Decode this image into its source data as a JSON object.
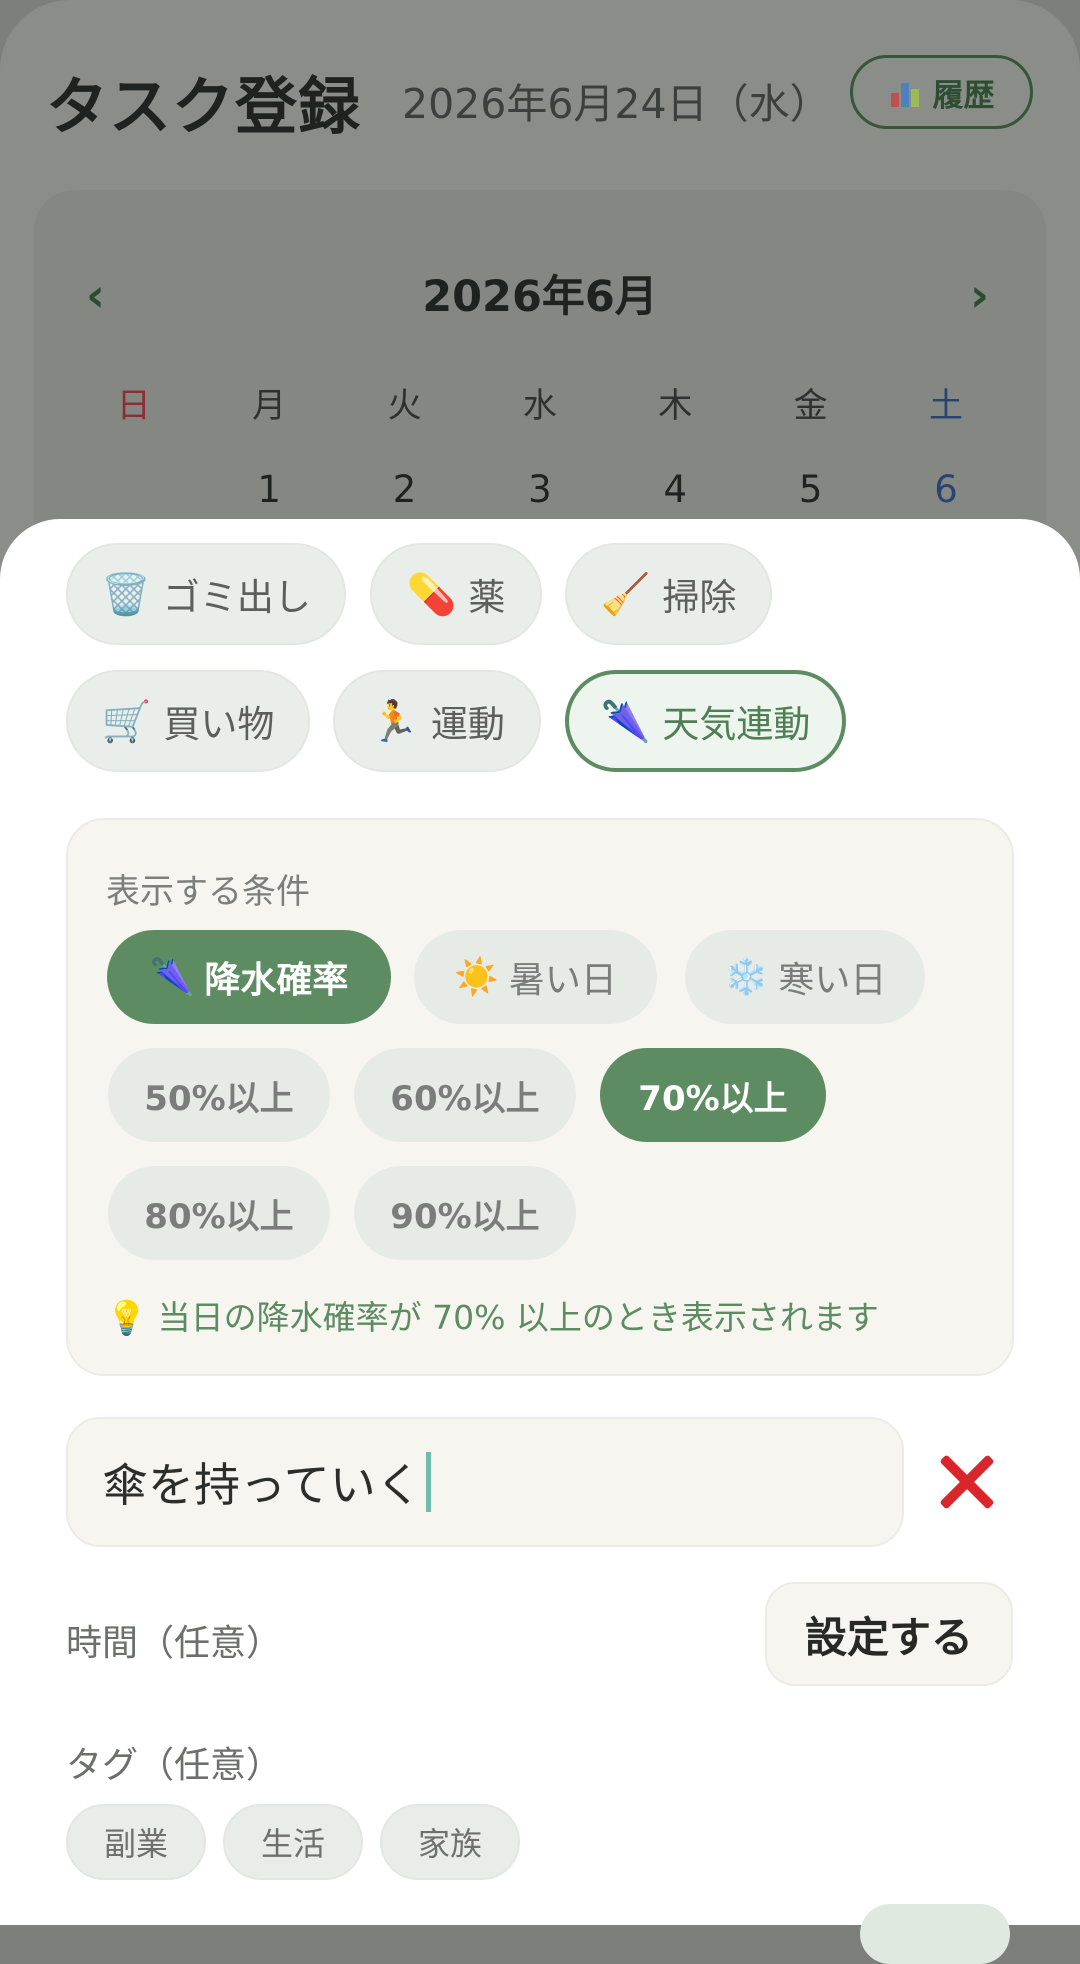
{
  "header": {
    "title": "タスク登録",
    "date": "2026年6月24日（水）",
    "history_label": "履歴",
    "history_icon": "bar-chart-icon"
  },
  "calendar": {
    "month": "2026年6月",
    "prev": "‹",
    "next": "›",
    "weekdays": [
      "日",
      "月",
      "火",
      "水",
      "木",
      "金",
      "土"
    ],
    "first_row": [
      "",
      "1",
      "2",
      "3",
      "4",
      "5",
      "6"
    ]
  },
  "categories": [
    {
      "icon": "🗑️",
      "icon_name": "trash-can-icon",
      "label": "ゴミ出し",
      "active": false
    },
    {
      "icon": "💊",
      "icon_name": "pill-icon",
      "label": "薬",
      "active": false
    },
    {
      "icon": "🧹",
      "icon_name": "broom-icon",
      "label": "掃除",
      "active": false
    },
    {
      "icon": "🛒",
      "icon_name": "shopping-cart-icon",
      "label": "買い物",
      "active": false
    },
    {
      "icon": "🏃",
      "icon_name": "runner-icon",
      "label": "運動",
      "active": false
    },
    {
      "icon": "🌂",
      "icon_name": "umbrella-icon",
      "label": "天気連動",
      "active": true
    }
  ],
  "conditions": {
    "label": "表示する条件",
    "types": [
      {
        "icon": "🌂",
        "icon_name": "umbrella-icon",
        "label": "降水確率",
        "selected": true
      },
      {
        "icon": "☀️",
        "icon_name": "sun-icon",
        "label": "暑い日",
        "selected": false
      },
      {
        "icon": "❄️",
        "icon_name": "snowflake-icon",
        "label": "寒い日",
        "selected": false
      }
    ],
    "thresholds": [
      "50%以上",
      "60%以上",
      "70%以上",
      "80%以上",
      "90%以上"
    ],
    "selected_threshold": "70%以上",
    "hint_icon": "💡",
    "hint": "当日の降水確率が 70% 以上のとき表示されます"
  },
  "task": {
    "value": "傘を持っていく",
    "clear_icon": "close-icon"
  },
  "time": {
    "label": "時間（任意）",
    "button": "設定する"
  },
  "tags": {
    "label": "タグ（任意）",
    "items": [
      "副業",
      "生活",
      "家族"
    ]
  },
  "colors": {
    "accent": "#5d8c62",
    "danger": "#d8262a",
    "sunday": "#8a2f35",
    "saturday": "#2a4472"
  }
}
